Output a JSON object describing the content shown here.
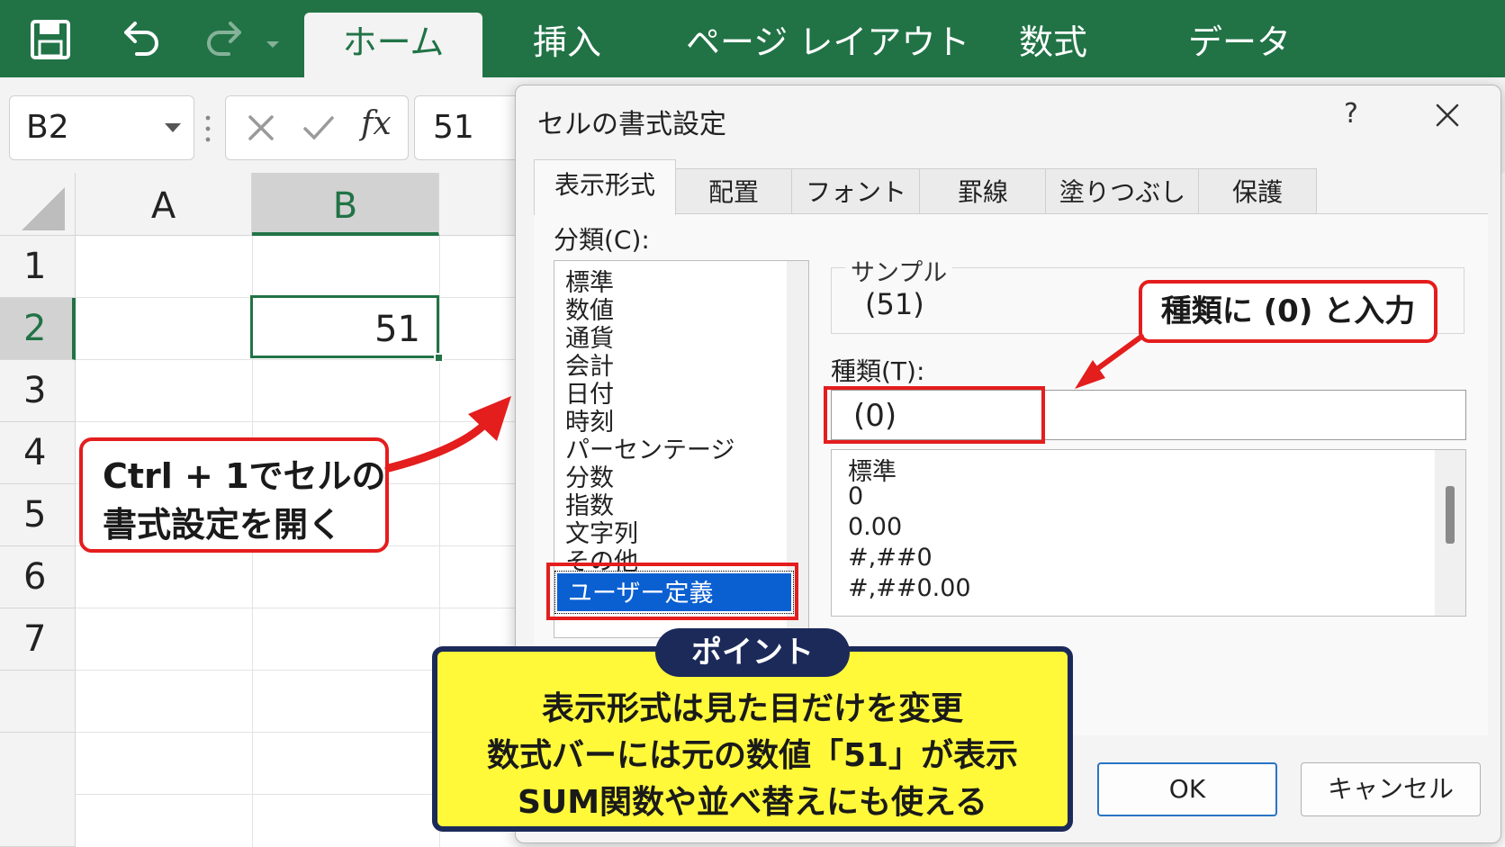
{
  "ribbon": {
    "tabs": [
      {
        "label": "ホーム",
        "active": true
      },
      {
        "label": "挿入"
      },
      {
        "label": "ページ レイアウト"
      },
      {
        "label": "数式"
      },
      {
        "label": "データ"
      }
    ],
    "icons": [
      "save-icon",
      "undo-icon",
      "redo-icon"
    ],
    "color": "#217346"
  },
  "formula_bar": {
    "name_box": "B2",
    "fx_label": "fx",
    "value": "51"
  },
  "sheet": {
    "columns": [
      "A",
      "B"
    ],
    "rows": [
      "1",
      "2",
      "3",
      "4",
      "5",
      "6",
      "7"
    ],
    "selected_cell_value": "51"
  },
  "dialog": {
    "title": "セルの書式設定",
    "help": "?",
    "tabs": [
      "表示形式",
      "配置",
      "フォント",
      "罫線",
      "塗りつぶし",
      "保護"
    ],
    "category_label": "分類(C):",
    "categories": [
      "標準",
      "数値",
      "通貨",
      "会計",
      "日付",
      "時刻",
      "パーセンテージ",
      "分数",
      "指数",
      "文字列",
      "その他"
    ],
    "selected_category": "ユーザー定義",
    "sample_label": "サンプル",
    "sample_value": "(51)",
    "type_label": "種類(T):",
    "type_value": "(0)",
    "formats": [
      "標準",
      "0",
      "0.00",
      "#,##0",
      "#,##0.00"
    ],
    "ok": "OK",
    "cancel": "キャンセル"
  },
  "annotations": {
    "callout_shortcut": [
      "Ctrl + 1でセルの",
      "書式設定を開く"
    ],
    "callout_type": "種類に (0) と入力",
    "point_tag": "ポイント",
    "point_lines": [
      "表示形式は見た目だけを変更",
      "数式バーには元の数値「51」が表示",
      "SUM関数や並べ替えにも使える"
    ],
    "highlight_color": "#e41d1d",
    "point_bg": "#fff93a",
    "point_border": "#1c2a5a"
  }
}
